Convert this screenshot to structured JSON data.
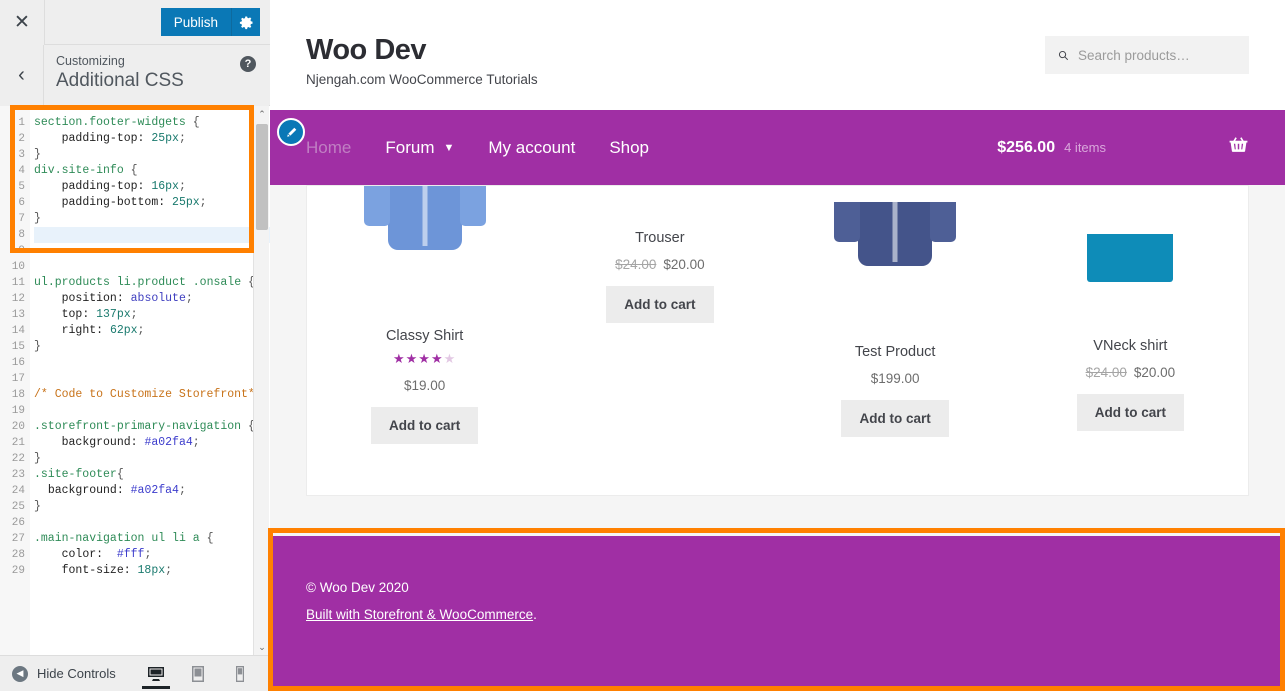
{
  "customizer": {
    "close_icon": "close-icon",
    "publish_label": "Publish",
    "gear_icon": "gear-icon",
    "back_icon": "back-chevron-icon",
    "breadcrumb": "Customizing",
    "panel_title": "Additional CSS",
    "help_label": "?",
    "hide_controls_label": "Hide Controls",
    "devices": [
      {
        "name": "desktop",
        "active": true
      },
      {
        "name": "tablet",
        "active": false
      },
      {
        "name": "mobile",
        "active": false
      }
    ],
    "scroll_up": "⌃",
    "scroll_down": "⌄"
  },
  "code": {
    "lines": [
      {
        "n": 1,
        "html": "<span class='sel'>section</span><span class='cls'>.footer-widgets</span> <span class='pun'>{</span>"
      },
      {
        "n": 2,
        "html": "    <span class='prop'>padding-top:</span> <span class='val'>25px</span><span class='pun'>;</span>"
      },
      {
        "n": 3,
        "html": "<span class='pun'>}</span>"
      },
      {
        "n": 4,
        "html": "<span class='sel'>div</span><span class='cls'>.site-info</span> <span class='pun'>{</span>"
      },
      {
        "n": 5,
        "html": "    <span class='prop'>padding-top:</span> <span class='val'>16px</span><span class='pun'>;</span>"
      },
      {
        "n": 6,
        "html": "    <span class='prop'>padding-bottom:</span> <span class='val'>25px</span><span class='pun'>;</span>"
      },
      {
        "n": 7,
        "html": "<span class='pun'>}</span>"
      },
      {
        "n": 8,
        "html": "",
        "hl": true
      },
      {
        "n": 9,
        "html": ""
      },
      {
        "n": 10,
        "html": ""
      },
      {
        "n": 11,
        "html": "<span class='sel'>ul</span><span class='cls'>.products</span> <span class='sel'>li</span><span class='cls'>.product</span> <span class='cls'>.onsale</span> <span class='pun'>{</span>"
      },
      {
        "n": 12,
        "html": "    <span class='prop'>position:</span> <span class='kw'>absolute</span><span class='pun'>;</span>"
      },
      {
        "n": 13,
        "html": "    <span class='prop'>top:</span> <span class='val'>137px</span><span class='pun'>;</span>"
      },
      {
        "n": 14,
        "html": "    <span class='prop'>right:</span> <span class='val'>62px</span><span class='pun'>;</span>"
      },
      {
        "n": 15,
        "html": "<span class='pun'>}</span>"
      },
      {
        "n": 16,
        "html": ""
      },
      {
        "n": 17,
        "html": ""
      },
      {
        "n": 18,
        "html": "<span class='cmt'>/* Code to Customize Storefront*/</span>"
      },
      {
        "n": 19,
        "html": ""
      },
      {
        "n": 20,
        "html": "<span class='cls'>.storefront-primary-navigation</span> <span class='pun'>{</span>"
      },
      {
        "n": 21,
        "html": "    <span class='prop'>background:</span> <span class='hex'>#a02fa4</span><span class='pun'>;</span>"
      },
      {
        "n": 22,
        "html": "<span class='pun'>}</span>"
      },
      {
        "n": 23,
        "html": "<span class='cls'>.site-footer</span><span class='pun'>{</span>"
      },
      {
        "n": 24,
        "html": "  <span class='prop'>background:</span> <span class='hex'>#a02fa4</span><span class='pun'>;</span>"
      },
      {
        "n": 25,
        "html": "<span class='pun'>}</span>"
      },
      {
        "n": 26,
        "html": ""
      },
      {
        "n": 27,
        "html": "<span class='cls'>.main-navigation</span> <span class='sel'>ul</span> <span class='sel'>li</span> <span class='sel'>a</span> <span class='pun'>{</span>"
      },
      {
        "n": 28,
        "html": "    <span class='prop'>color:</span>  <span class='hex'>#fff</span><span class='pun'>;</span>"
      },
      {
        "n": 29,
        "html": "    <span class='prop'>font-size:</span> <span class='val'>18px</span><span class='pun'>;</span>"
      }
    ],
    "plain_text": "section.footer-widgets {\n    padding-top: 25px;\n}\ndiv.site-info {\n    padding-top: 16px;\n    padding-bottom: 25px;\n}\n\n\n\nul.products li.product .onsale {\n    position: absolute;\n    top: 137px;\n    right: 62px;\n}\n\n\n/* Code to Customize Storefront*/\n\n.storefront-primary-navigation {\n    background: #a02fa4;\n}\n.site-footer{\n  background: #a02fa4;\n}\n\n.main-navigation ul li a {\n    color:  #fff;\n    font-size: 18px;"
  },
  "site": {
    "title": "Woo Dev",
    "description": "Njengah.com WooCommerce Tutorials",
    "search": {
      "placeholder": "Search products…",
      "value": "",
      "icon": "search-icon"
    },
    "nav": [
      {
        "label": "Home",
        "current": true,
        "has_dropdown": false
      },
      {
        "label": "Forum",
        "current": false,
        "has_dropdown": true
      },
      {
        "label": "My account",
        "current": false,
        "has_dropdown": false
      },
      {
        "label": "Shop",
        "current": false,
        "has_dropdown": false
      }
    ],
    "cart": {
      "total": "$256.00",
      "count": "4 items",
      "icon": "shopping-basket-icon"
    },
    "edit_shortcut_icon": "pencil-edit-icon",
    "footer": {
      "copyright": "© Woo Dev 2020",
      "built_with_text": "Built with Storefront & WooCommerce",
      "built_with_period": "."
    }
  },
  "products": [
    {
      "name": "Classy Shirt",
      "rating": 4,
      "rating_max": 5,
      "price": "$19.00",
      "regular_price": "",
      "add_to_cart": "Add to cart",
      "image": "blue-dress-shirt"
    },
    {
      "name": "Trouser",
      "rating": 0,
      "rating_max": 5,
      "price": "$20.00",
      "regular_price": "$24.00",
      "add_to_cart": "Add to cart",
      "image": "none"
    },
    {
      "name": "Test Product",
      "rating": 0,
      "rating_max": 5,
      "price": "$199.00",
      "regular_price": "",
      "add_to_cart": "Add to cart",
      "image": "navy-dress-shirt"
    },
    {
      "name": "VNeck shirt",
      "rating": 0,
      "rating_max": 5,
      "price": "$20.00",
      "regular_price": "$24.00",
      "add_to_cart": "Add to cart",
      "image": "teal-vneck-tee"
    }
  ],
  "colors": {
    "brand_purple": "#a02fa4",
    "highlight_orange": "#ff8000",
    "publish_blue": "#0a78b6",
    "button_grey": "#ececec"
  },
  "annotations": [
    {
      "name": "css-rule-highlight",
      "target": "editor-top-rules"
    },
    {
      "name": "footer-highlight",
      "target": "site-footer"
    }
  ]
}
